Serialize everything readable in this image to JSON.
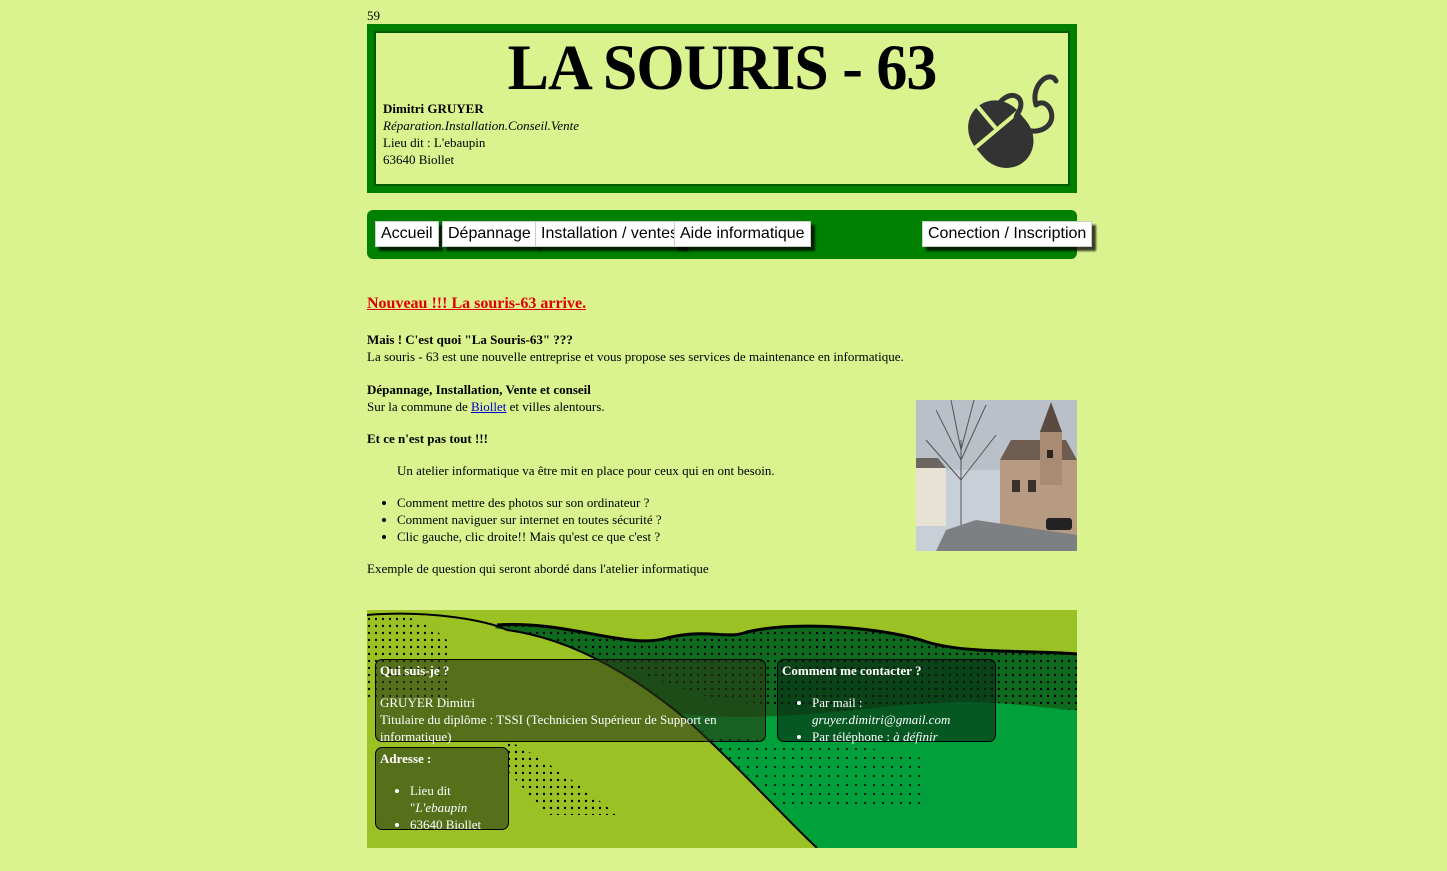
{
  "counter": "59",
  "header": {
    "title": "LA SOURIS - 63",
    "name": "Dimitri GRUYER",
    "tagline": "Réparation.Installation.Conseil.Vente",
    "address_line": "Lieu dit : L'ebaupin",
    "city": "63640 Biollet",
    "logo_icon": "mouse-icon"
  },
  "nav": {
    "items": [
      "Accueil",
      "Dépannage",
      "Installation / ventes",
      "Aide informatique"
    ],
    "login": "Conection / Inscription"
  },
  "content": {
    "news": "Nouveau !!! La souris-63 arrive.",
    "q1_title": "Mais ! C'est quoi \"La Souris-63\" ???",
    "q1_text": "La souris - 63 est une nouvelle entreprise et vous propose ses services de maintenance en informatique.",
    "q2_title": "Dépannage, Installation, Vente et conseil",
    "q2_prefix": "Sur la commune de ",
    "q2_link": "Biollet",
    "q2_suffix": " et villes alentours.",
    "q3_title": "Et ce n'est pas tout !!!",
    "q3_text": "Un atelier informatique va être mit en place pour ceux qui en ont besoin.",
    "bullets": [
      "Comment mettre des photos sur son ordinateur ?",
      "Comment naviguer sur internet en toutes sécurité ?",
      "Clic gauche, clic droite!! Mais qu'est ce que c'est ?"
    ],
    "footer_note": "Exemple de question qui seront abordé dans l'atelier informatique"
  },
  "footer": {
    "about_title": "Qui suis-je ?",
    "about_name": "GRUYER Dimitri",
    "about_diploma": "Titulaire du diplôme : TSSI (Technicien Supérieur de Support en informatique)",
    "contact_title": "Comment me contacter ?",
    "mail_label": "Par mail : ",
    "mail_value": "gruyer.dimitri@gmail.com",
    "phone_label": "Par téléphone : ",
    "phone_value": "à définir",
    "address_title": "Adresse :",
    "address_prefix": "Lieu dit \"",
    "address_place": "L'ebaupin",
    "address_city": "63640 Biollet"
  },
  "colors": {
    "background": "#dbf38f",
    "green": "#008000",
    "news_red": "#e00000"
  }
}
